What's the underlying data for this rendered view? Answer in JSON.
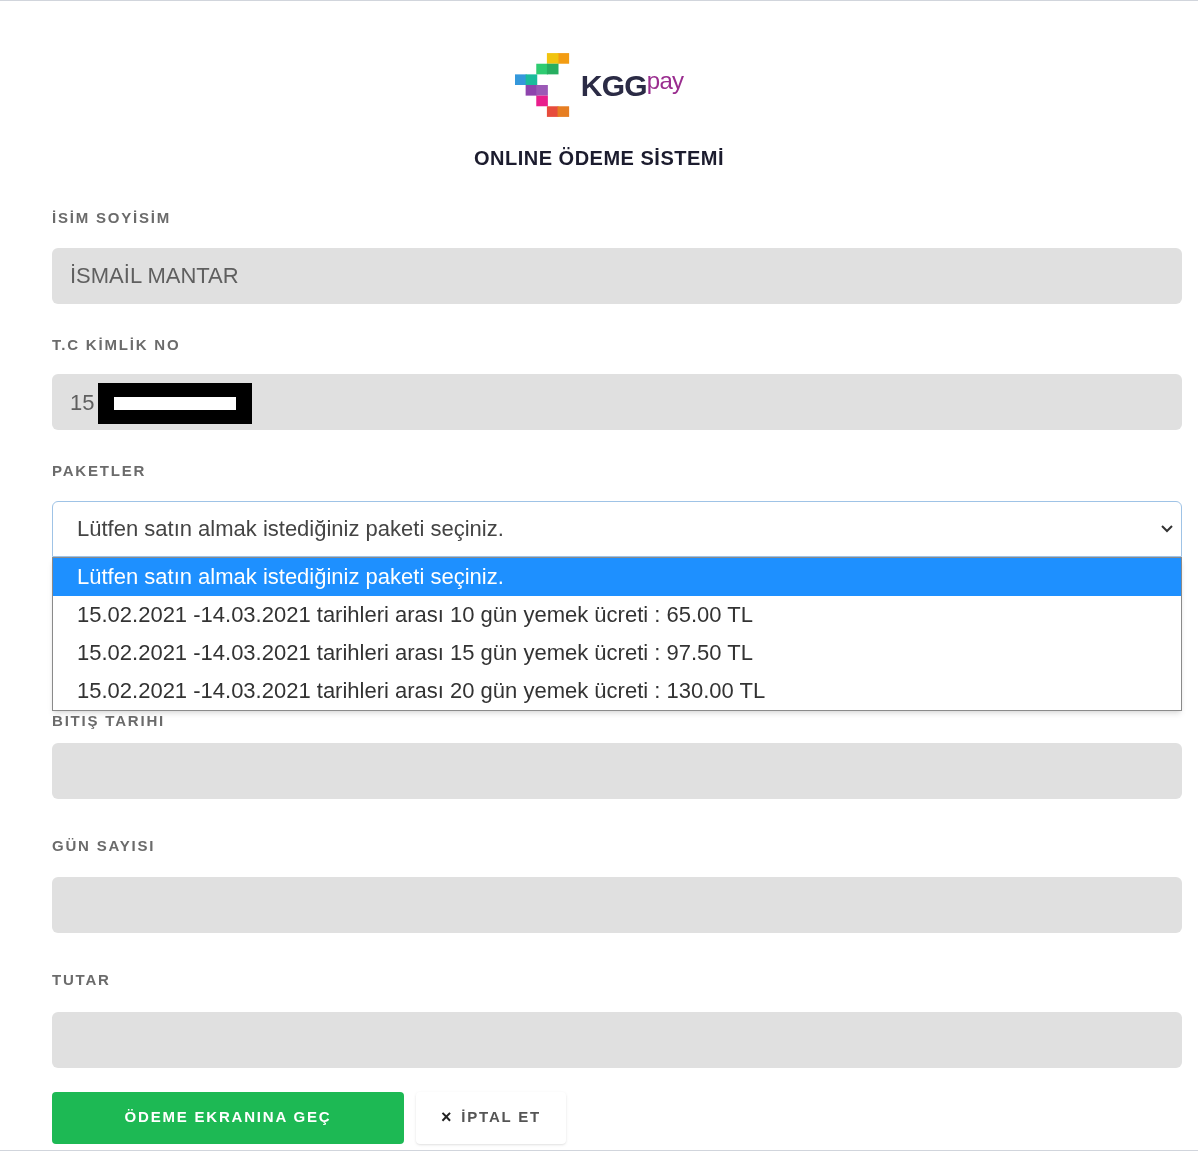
{
  "logo": {
    "text": "KGG",
    "accent": "pay"
  },
  "title": "ONLINE ÖDEME SİSTEMİ",
  "fields": [
    {
      "label": "İSİM SOYİSİM",
      "value": "İSMAİL MANTAR"
    },
    {
      "label": "T.C KİMLİK NO",
      "value": "15",
      "redacted": true
    }
  ],
  "packages": {
    "label": "PAKETLER",
    "value": "Lütfen satın almak istediğiniz paketi seçiniz.",
    "expanded": true,
    "options": [
      {
        "text": "Lütfen satın almak istediğiniz paketi seçiniz.",
        "selected": true
      },
      {
        "text": "15.02.2021 -14.03.2021 tarihleri arası 10 gün yemek ücreti : 65.00 TL",
        "selected": false
      },
      {
        "text": "15.02.2021 -14.03.2021 tarihleri arası 15 gün yemek ücreti : 97.50 TL",
        "selected": false
      },
      {
        "text": "15.02.2021 -14.03.2021 tarihleri arası 20 gün yemek ücreti : 130.00 TL",
        "selected": false
      }
    ]
  },
  "lower_fields": [
    {
      "label": "BITIŞ TARIHI"
    },
    {
      "label": "GÜN SAYISI"
    },
    {
      "label": "TUTAR"
    }
  ],
  "buttons": {
    "primary": "ÖDEME EKRANINA GEÇ",
    "cancel_icon": "×",
    "cancel": "İPTAL ET"
  }
}
